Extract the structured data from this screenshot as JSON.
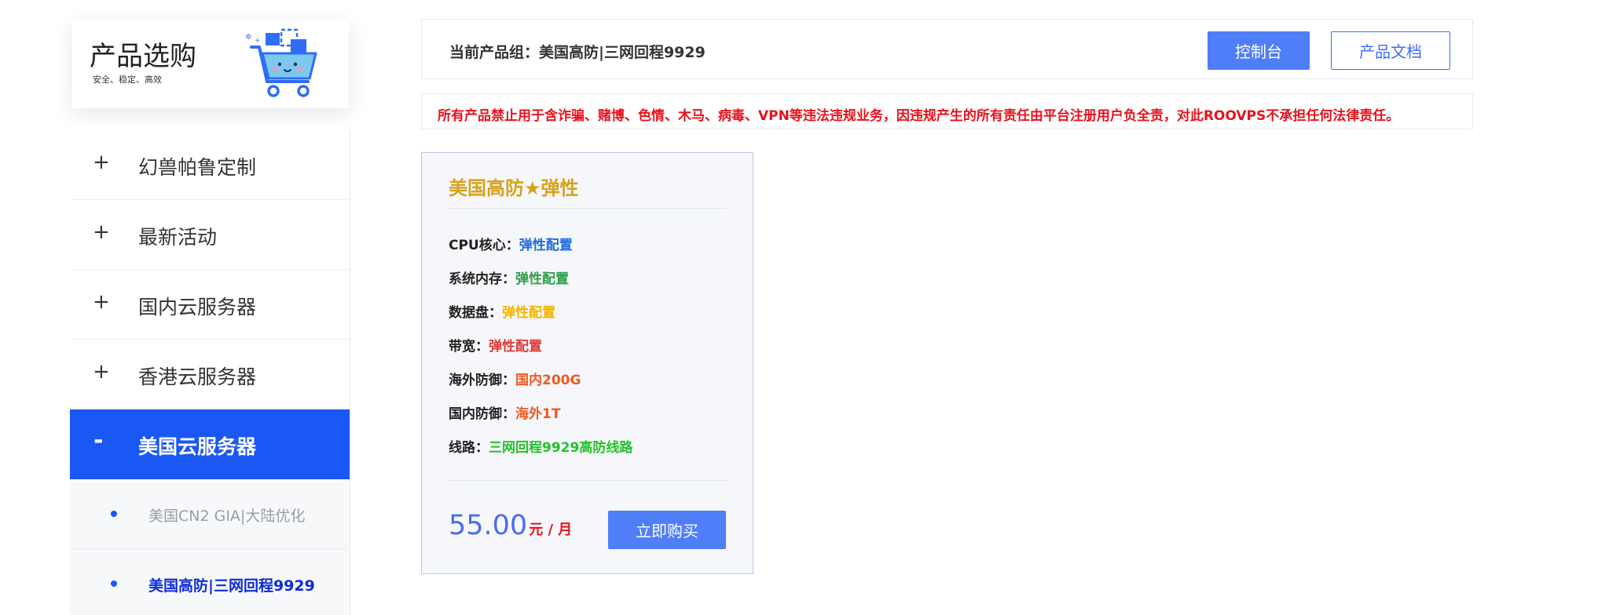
{
  "brand": {
    "title": "产品选购",
    "subtitle": "安全、稳定、高效"
  },
  "sidebar": {
    "items": [
      {
        "sign": "+",
        "label": "幻兽帕鲁定制"
      },
      {
        "sign": "+",
        "label": "最新活动"
      },
      {
        "sign": "+",
        "label": "国内云服务器"
      },
      {
        "sign": "+",
        "label": "香港云服务器"
      },
      {
        "sign": "-",
        "label": "美国云服务器"
      }
    ],
    "subitems": [
      {
        "label": "美国CN2 GIA|大陆优化"
      },
      {
        "label": "美国高防|三网回程9929"
      }
    ]
  },
  "topbar": {
    "group_text": "当前产品组：美国高防|三网回程9929",
    "console_label": "控制台",
    "docs_label": "产品文档"
  },
  "warning": {
    "text": "所有产品禁止用于含诈骗、赌博、色情、木马、病毒、VPN等违法违规业务，因违规产生的所有责任由平台注册用户负全责，对此ROOVPS不承担任何法律责任。"
  },
  "card": {
    "title": "美国高防★弹性",
    "specs": [
      {
        "label": "CPU核心：",
        "value": "弹性配置",
        "color": "#1f6ce0"
      },
      {
        "label": "系统内存：",
        "value": "弹性配置",
        "color": "#2aa14a"
      },
      {
        "label": "数据盘：",
        "value": "弹性配置",
        "color": "#f4b400"
      },
      {
        "label": "带宽：",
        "value": "弹性配置",
        "color": "#e03a3a"
      },
      {
        "label": "海外防御：",
        "value": "国内200G",
        "color": "#f05a1f"
      },
      {
        "label": "国内防御：",
        "value": "海外1T",
        "color": "#f05a1f"
      },
      {
        "label": "线路：",
        "value": "三网回程9929高防线路",
        "color": "#22c22a"
      }
    ],
    "price": "55.00",
    "price_unit": "元 / 月",
    "buy_label": "立即购买"
  },
  "colors": {
    "accent": "#1a57f4",
    "button": "#4f7ef8",
    "warning": "#e8121b",
    "price": "#4a6cf0",
    "card_title": "#d7a21b"
  }
}
